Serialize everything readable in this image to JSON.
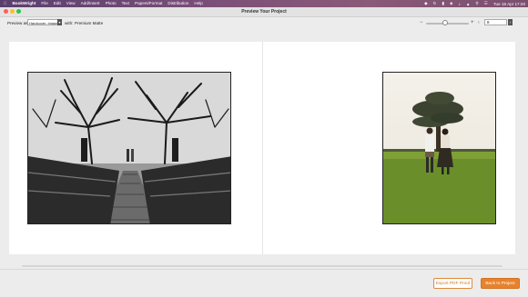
{
  "menubar": {
    "app_name": "BookWright",
    "items": [
      "File",
      "Edit",
      "View",
      "Add/Insert",
      "Photo",
      "Text",
      "Papers/Format",
      "Distribution",
      "Help"
    ],
    "clock": "Tue 15 Apr  17:20"
  },
  "window": {
    "title": "Preview Your Project"
  },
  "toolbar": {
    "preview_as_label": "Preview as",
    "format_value": "Hardcover, ImageWrap",
    "with_label": "with:",
    "finish_value": "Premium Matte",
    "zoom_level": 0.45,
    "page_value": "8"
  },
  "footer": {
    "export_label": "Export PDF Proof",
    "back_label": "Back to Project"
  },
  "colors": {
    "accent": "#e7822d",
    "menubar": "#6b4a72"
  }
}
